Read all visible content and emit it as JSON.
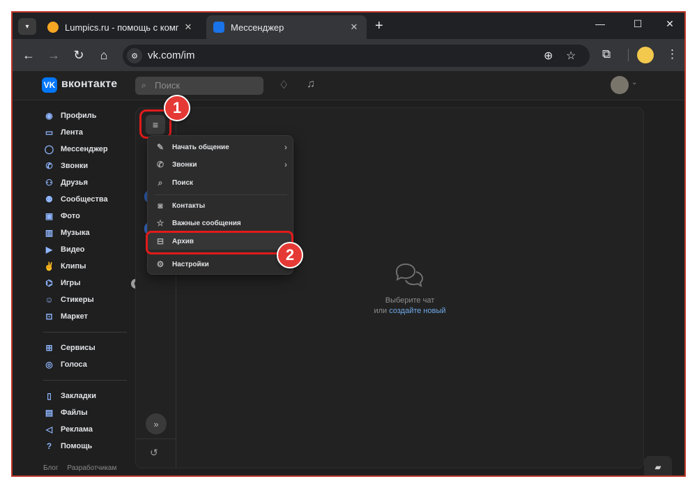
{
  "browser": {
    "tabs": [
      {
        "title": "Lumpics.ru - помощь с компь",
        "favicon_color": "#f5a623",
        "active": false
      },
      {
        "title": "Мессенджер",
        "favicon_color": "#1a73e8",
        "active": true
      }
    ],
    "url": "vk.com/im"
  },
  "vk": {
    "brand": "вконтакте",
    "search_placeholder": "Поиск"
  },
  "sidebar": {
    "items": [
      {
        "label": "Профиль",
        "icon": "profile-icon"
      },
      {
        "label": "Лента",
        "icon": "feed-icon"
      },
      {
        "label": "Мессенджер",
        "icon": "messenger-icon"
      },
      {
        "label": "Звонки",
        "icon": "phone-icon"
      },
      {
        "label": "Друзья",
        "icon": "friends-icon"
      },
      {
        "label": "Сообщества",
        "icon": "communities-icon"
      },
      {
        "label": "Фото",
        "icon": "photo-icon"
      },
      {
        "label": "Музыка",
        "icon": "music-icon"
      },
      {
        "label": "Видео",
        "icon": "video-icon"
      },
      {
        "label": "Клипы",
        "icon": "clips-icon"
      },
      {
        "label": "Игры",
        "icon": "games-icon",
        "badge": "6"
      },
      {
        "label": "Стикеры",
        "icon": "stickers-icon"
      },
      {
        "label": "Маркет",
        "icon": "market-icon"
      }
    ],
    "items2": [
      {
        "label": "Сервисы",
        "icon": "services-icon"
      },
      {
        "label": "Голоса",
        "icon": "votes-icon"
      }
    ],
    "items3": [
      {
        "label": "Закладки",
        "icon": "bookmark-icon"
      },
      {
        "label": "Файлы",
        "icon": "files-icon"
      },
      {
        "label": "Реклама",
        "icon": "ads-icon"
      },
      {
        "label": "Помощь",
        "icon": "help-icon"
      }
    ],
    "footer": {
      "blog": "Блог",
      "devs": "Разработчикам"
    }
  },
  "menu": {
    "start_chat": "Начать общение",
    "calls": "Звонки",
    "search": "Поиск",
    "contacts": "Контакты",
    "important": "Важные сообщения",
    "archive": "Архив",
    "settings": "Настройки"
  },
  "empty_state": {
    "line1": "Выберите чат",
    "line2_prefix": "или ",
    "line2_link": "создайте новый"
  },
  "callouts": {
    "one": "1",
    "two": "2"
  },
  "colors": {
    "accent": "#0077ff",
    "highlight": "#e21b1b",
    "link": "#71aaeb"
  }
}
